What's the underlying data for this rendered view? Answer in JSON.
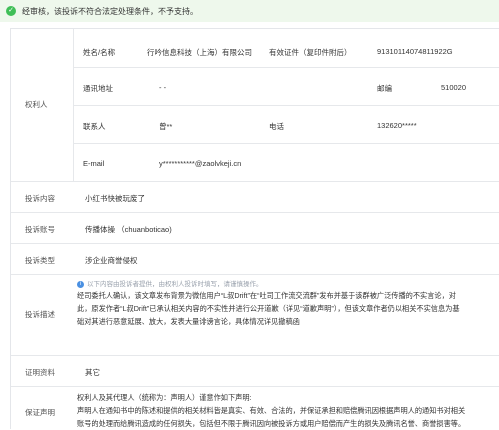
{
  "notice": {
    "text": "经审核，该投诉不符合法定处理条件，不予支持。"
  },
  "rights_holder": {
    "section_label": "权利人",
    "name_label": "姓名/名称",
    "name_value": "行吟信息科技（上海）有限公司",
    "id_label": "有效证件（复印件附后）",
    "id_value": "91310114074811922G",
    "address_label": "通讯地址",
    "address_value": "- -",
    "zip_label": "邮编",
    "zip_value": "510020",
    "contact_label": "联系人",
    "contact_value": "曾**",
    "phone_label": "电话",
    "phone_value": "132620*****",
    "email_label": "E-mail",
    "email_value": "y***********@zaolvkeji.cn"
  },
  "complaint_content": {
    "label": "投诉内容",
    "value": "小红书快被玩废了"
  },
  "complaint_account": {
    "label": "投诉账号",
    "value": "传播体操 （chuanboticao)"
  },
  "complaint_type": {
    "label": "投诉类型",
    "value": "涉企业商誉侵权"
  },
  "complaint_desc": {
    "label": "投诉描述",
    "tip": "以下内容由投诉者提供，由权利人投诉时填写，请谨慎操作。",
    "line1": "经司委托人确认，该文章发布背景为微信用户“L叔Drift”在“吐司工作流交流群”发布并基于该群被广泛传播的不实言论，对",
    "line2": "此，原发作者“L叔Drift”已承认相关内容的不实性并进行公开道歉（详见“道歉声明”），但该文章作者仍以相关不实信息为基",
    "line3": "础对其进行恶意延展、放大，发表大量诽谤言论，具体情况详见撤稿函"
  },
  "evidence": {
    "label": "证明资料",
    "value": "其它"
  },
  "guarantee": {
    "label": "保证声明",
    "line1": "权利人及其代理人（统称为：声明人）谨意作如下声明:",
    "line2": "声明人在通知书中的陈述和提供的相关材料皆是真实、有效、合法的，并保证承担和赔偿腾讯因根据声明人的通知书对相关",
    "line3": "账号的处理而给腾讯造成的任何损失，包括但不限于腾讯因向被投诉方或用户赔偿而产生的损失及腾讯名誉、商誉损害等。"
  }
}
